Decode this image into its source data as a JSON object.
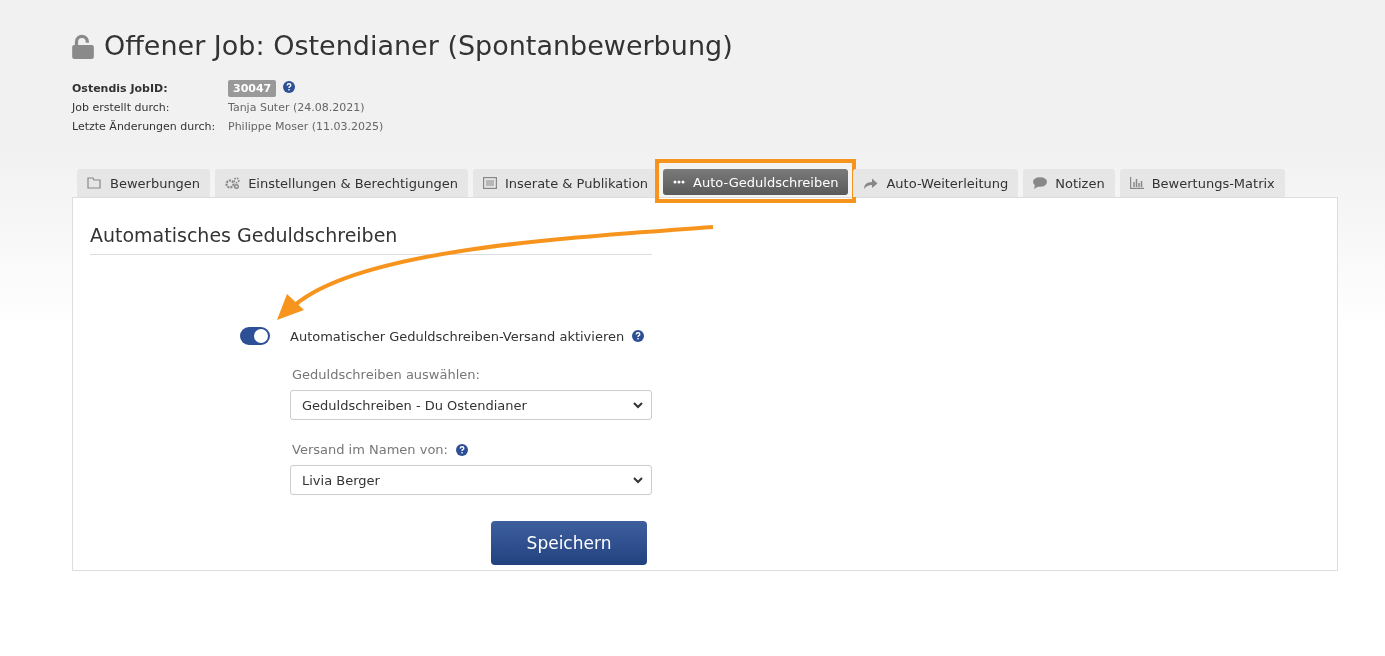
{
  "header": {
    "title": "Offener Job: Ostendianer (Spontanbewerbung)",
    "locked": false,
    "meta": [
      {
        "label": "Ostendis JobID:",
        "value": "30047",
        "kind": "badge"
      },
      {
        "label": "Job erstellt durch:",
        "value": "Tanja Suter (24.08.2021)",
        "kind": "text"
      },
      {
        "label": "Letzte Änderungen durch:",
        "value": "Philippe Moser (11.03.2025)",
        "kind": "text"
      }
    ]
  },
  "tabs": [
    {
      "label": "Bewerbungen",
      "selected": false,
      "highlighted": false
    },
    {
      "label": "Einstellungen & Berechtigungen",
      "selected": false,
      "highlighted": false
    },
    {
      "label": "Inserate & Publikation",
      "selected": false,
      "highlighted": false
    },
    {
      "label": "Auto-Geduldschreiben",
      "selected": true,
      "highlighted": true
    },
    {
      "label": "Auto-Weiterleitung",
      "selected": false,
      "highlighted": false
    },
    {
      "label": "Notizen",
      "selected": false,
      "highlighted": false
    },
    {
      "label": "Bewertungs-Matrix",
      "selected": false,
      "highlighted": false
    }
  ],
  "panel": {
    "heading": "Automatisches Geduldschreiben",
    "toggle": {
      "label": "Automatischer Geduldschreiben-Versand aktivieren",
      "on": true
    },
    "fields": [
      {
        "label": "Geduldschreiben auswählen:",
        "value": "Geduldschreiben - Du Ostendianer",
        "help": false
      },
      {
        "label": "Versand im Namen von:",
        "value": "Livia Berger",
        "help": true
      }
    ],
    "button": "Speichern"
  }
}
